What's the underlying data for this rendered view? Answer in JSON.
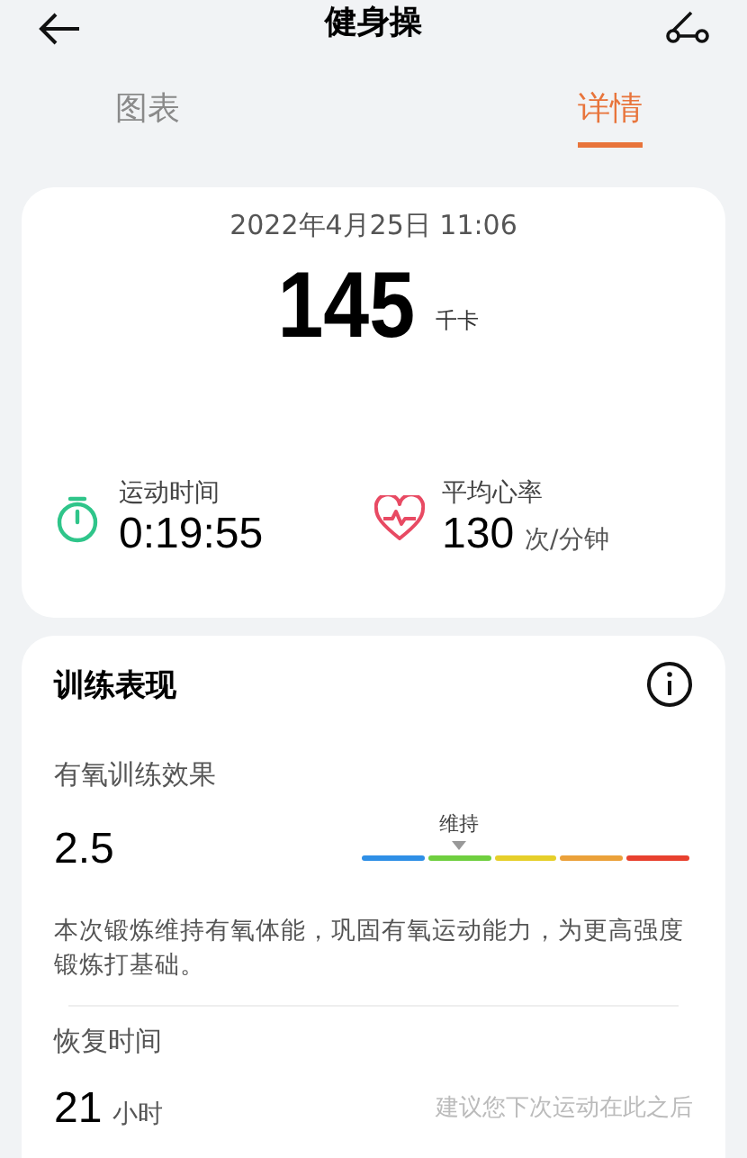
{
  "header": {
    "title": "健身操"
  },
  "tabs": [
    {
      "label": "图表",
      "selected": false
    },
    {
      "label": "详情",
      "selected": true
    }
  ],
  "summary": {
    "datetime": "2022年4月25日 11:06",
    "calories": "145",
    "calories_unit": "千卡",
    "stats": [
      {
        "kind": "timer",
        "label": "运动时间",
        "value": "0:19:55"
      },
      {
        "kind": "heart",
        "label": "平均心率",
        "value": "130",
        "unit": "次/分钟"
      }
    ]
  },
  "performance": {
    "title": "训练表现",
    "aerobic": {
      "label": "有氧训练效果",
      "value": "2.5",
      "scale_label": "维持",
      "segments": [
        {
          "color": "#2f8fe6",
          "selected": false
        },
        {
          "color": "#6fcf3f",
          "selected": true
        },
        {
          "color": "#e6cf2a",
          "selected": false
        },
        {
          "color": "#eba13a",
          "selected": false
        },
        {
          "color": "#e8412f",
          "selected": false
        }
      ],
      "description": "本次锻炼维持有氧体能，巩固有氧运动能力，为更高强度锻炼打基础。"
    },
    "recovery": {
      "label": "恢复时间",
      "value": "21",
      "unit": "小时",
      "note": "建议您下次运动在此之后"
    }
  }
}
